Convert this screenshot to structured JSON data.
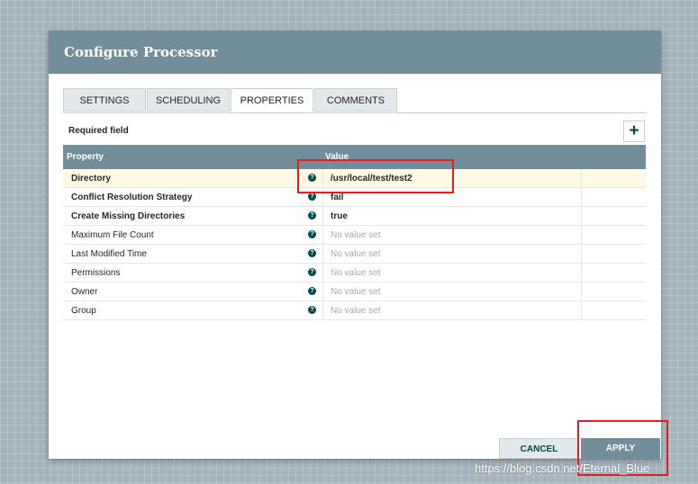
{
  "dialog": {
    "title": "Configure Processor"
  },
  "tabs": [
    {
      "label": "SETTINGS",
      "active": false
    },
    {
      "label": "SCHEDULING",
      "active": false
    },
    {
      "label": "PROPERTIES",
      "active": true
    },
    {
      "label": "COMMENTS",
      "active": false
    }
  ],
  "properties": {
    "required_label": "Required field",
    "add_icon": "+",
    "columns": {
      "property": "Property",
      "value": "Value"
    },
    "help_glyph": "?",
    "rows": [
      {
        "name": "Directory",
        "value": "/usr/local/test/test2",
        "required": true,
        "set": true
      },
      {
        "name": "Conflict Resolution Strategy",
        "value": "fail",
        "required": true,
        "set": true
      },
      {
        "name": "Create Missing Directories",
        "value": "true",
        "required": true,
        "set": true
      },
      {
        "name": "Maximum File Count",
        "value": "No value set",
        "required": false,
        "set": false
      },
      {
        "name": "Last Modified Time",
        "value": "No value set",
        "required": false,
        "set": false
      },
      {
        "name": "Permissions",
        "value": "No value set",
        "required": false,
        "set": false
      },
      {
        "name": "Owner",
        "value": "No value set",
        "required": false,
        "set": false
      },
      {
        "name": "Group",
        "value": "No value set",
        "required": false,
        "set": false
      }
    ]
  },
  "footer": {
    "cancel_label": "CANCEL",
    "apply_label": "APPLY"
  },
  "watermark": "https://blog.csdn.net/Eternal_Blue",
  "colors": {
    "header": "#728e9b",
    "accent": "#004849",
    "annotation": "#e02020",
    "selected_row": "#fff9e5"
  }
}
